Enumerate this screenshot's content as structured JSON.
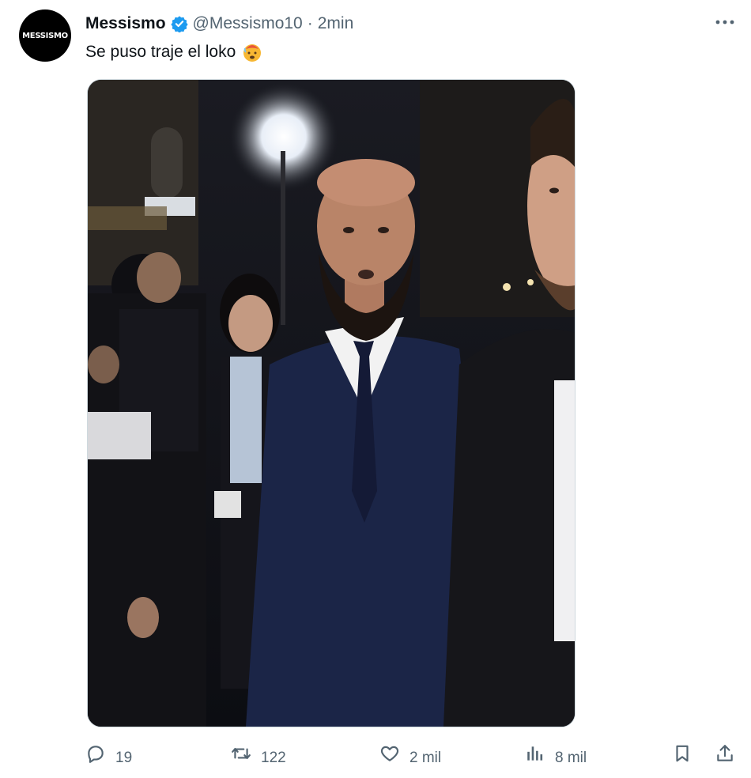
{
  "tweet": {
    "avatar_text": "MESSISMO",
    "display_name": "Messismo",
    "verified_icon": "verified-badge-icon",
    "handle": "@Messismo10",
    "separator": "·",
    "time": "2min",
    "text": "Se puso traje el loko",
    "emoji": "hot-face-emoji",
    "media_icon": "photo",
    "more_icon": "more-horizontal-icon"
  },
  "actions": {
    "reply": {
      "icon": "reply-icon",
      "count": "19"
    },
    "retweet": {
      "icon": "retweet-icon",
      "count": "122"
    },
    "like": {
      "icon": "heart-icon",
      "count": "2 mil"
    },
    "views": {
      "icon": "views-icon",
      "count": "8 mil"
    },
    "bookmark": {
      "icon": "bookmark-icon"
    },
    "share": {
      "icon": "share-icon"
    }
  },
  "colors": {
    "text": "#0f1419",
    "muted": "#536471",
    "verified": "#1d9bf0",
    "border": "#cfd9de"
  }
}
